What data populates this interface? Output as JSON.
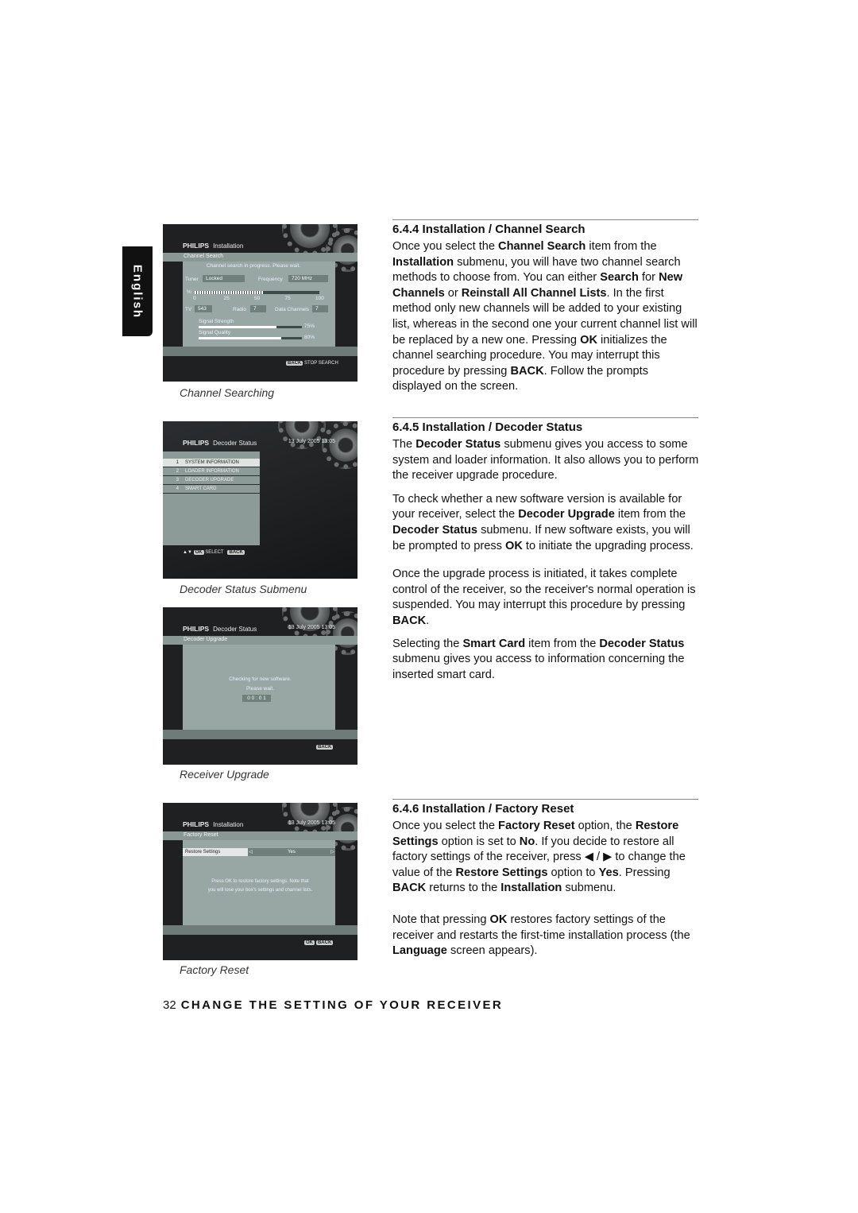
{
  "side_tab": "English",
  "screens": {
    "s1": {
      "brand": "PHILIPS",
      "menu": "Installation",
      "submenu": "Channel Search",
      "status": "Channel search in progress. Please wait.",
      "tuner_label": "Tuner",
      "tuner": "Locked",
      "freq_label": "Frequency",
      "freq": "720 MHz",
      "pct_label": "%",
      "progress_percent": 55,
      "ticks": [
        "0",
        "25",
        "50",
        "75",
        "100"
      ],
      "tv_label": "TV",
      "tv": "543",
      "radio_label": "Radio",
      "radio": "7",
      "data_label": "Data Channels",
      "data": "7",
      "strength_label": "Signal Strength",
      "strength": "75%",
      "strength_value": 75,
      "quality_label": "Signal Quality",
      "quality": "80%",
      "quality_value": 80,
      "back_key": "BACK",
      "back_action": "STOP SEARCH"
    },
    "s2": {
      "brand": "PHILIPS",
      "menu": "Decoder Status",
      "date": "13 July 2005   13:05",
      "items": [
        {
          "n": "1",
          "label": "SYSTEM INFORMATION"
        },
        {
          "n": "2",
          "label": "LOADER INFORMATION"
        },
        {
          "n": "3",
          "label": "DECODER UPGRADE"
        },
        {
          "n": "4",
          "label": "SMART CARD"
        }
      ],
      "ok_key": "OK",
      "select": "SELECT",
      "back_key": "BACK"
    },
    "s3": {
      "brand": "PHILIPS",
      "menu": "Decoder Status",
      "date": "13 July 2005   13:05",
      "submenu": "Decoder Upgrade",
      "msg1": "Checking for new software.",
      "msg2": "Please wait.",
      "timer": "0 0 : 0 1",
      "back_key": "BACK"
    },
    "s4": {
      "brand": "PHILIPS",
      "menu": "Installation",
      "date": "13 July 2005   13:05",
      "submenu": "Factory Reset",
      "setting": "Restore Settings",
      "value": "Yes",
      "msg1": "Press OK to restore factory settings. Note that",
      "msg2": "you will lose your box's settings and channel lists.",
      "ok_key": "OK",
      "back_key": "BACK"
    }
  },
  "captions": [
    "Channel Searching",
    "Decoder Status Submenu",
    "Receiver Upgrade",
    "Factory Reset"
  ],
  "sections": [
    {
      "title": "6.4.4   Installation / Channel Search",
      "paras": [
        [
          {
            "t": "Once you select the "
          },
          {
            "t": "Channel Search",
            "b": 1
          },
          {
            "t": " item from the "
          },
          {
            "t": "Installation",
            "b": 1
          },
          {
            "t": " submenu, you will have two channel search methods to choose from. You can either "
          },
          {
            "t": "Search",
            "b": 1
          },
          {
            "t": " for "
          },
          {
            "t": "New Channels",
            "b": 1
          },
          {
            "t": " or "
          },
          {
            "t": "Reinstall All Channel Lists",
            "b": 1
          },
          {
            "t": ". In the first method only new channels will be added to your existing list, whereas in the second one your current channel list will be replaced by a new one. Pressing "
          },
          {
            "t": "OK",
            "b": 1
          },
          {
            "t": " initializes the channel searching procedure. You may interrupt this procedure by pressing "
          },
          {
            "t": "BACK",
            "b": 1
          },
          {
            "t": ". Follow the prompts displayed on the screen."
          }
        ]
      ]
    },
    {
      "title": "6.4.5   Installation / Decoder Status",
      "paras": [
        [
          {
            "t": "The "
          },
          {
            "t": "Decoder Status",
            "b": 1
          },
          {
            "t": " submenu gives you access to some system and loader information. It also allows you to perform the receiver upgrade procedure."
          }
        ],
        [
          {
            "t": "To check whether a new software version is available for your receiver, select the "
          },
          {
            "t": "Decoder Upgrade",
            "b": 1
          },
          {
            "t": " item from the "
          },
          {
            "t": "Decoder Status",
            "b": 1
          },
          {
            "t": " submenu. If new software exists, you will be prompted to press "
          },
          {
            "t": "OK",
            "b": 1
          },
          {
            "t": " to initiate the upgrading process."
          }
        ],
        [
          {
            "t": "Once the upgrade process is initiated, it takes complete control of the receiver, so the receiver's normal operation is suspended. You may interrupt this procedure by pressing "
          },
          {
            "t": "BACK",
            "b": 1
          },
          {
            "t": "."
          }
        ],
        [
          {
            "t": "Selecting the "
          },
          {
            "t": "Smart Card",
            "b": 1
          },
          {
            "t": " item from the "
          },
          {
            "t": "Decoder Status",
            "b": 1
          },
          {
            "t": " submenu gives you access to information concerning the inserted smart card."
          }
        ]
      ]
    },
    {
      "title": "6.4.6   Installation / Factory Reset",
      "paras": [
        [
          {
            "t": "Once you select the "
          },
          {
            "t": "Factory Reset",
            "b": 1
          },
          {
            "t": " option, the "
          },
          {
            "t": "Restore Settings",
            "b": 1
          },
          {
            "t": " option is set to "
          },
          {
            "t": "No",
            "b": 1
          },
          {
            "t": ". If you decide to restore all factory settings of the receiver, press ◀ / ▶ to change the value of the "
          },
          {
            "t": "Restore Settings",
            "b": 1
          },
          {
            "t": " option to "
          },
          {
            "t": "Yes",
            "b": 1
          },
          {
            "t": ". Pressing "
          },
          {
            "t": "BACK",
            "b": 1
          },
          {
            "t": " returns to the "
          },
          {
            "t": "Installation",
            "b": 1
          },
          {
            "t": " submenu."
          }
        ],
        [
          {
            "t": "Note that pressing "
          },
          {
            "t": "OK",
            "b": 1
          },
          {
            "t": " restores factory settings of the receiver and restarts the first-time installation process (the "
          },
          {
            "t": "Language",
            "b": 1
          },
          {
            "t": " screen appears)."
          }
        ]
      ]
    }
  ],
  "footer": {
    "page": "32",
    "title": "CHANGE THE SETTING OF YOUR RECEIVER"
  }
}
